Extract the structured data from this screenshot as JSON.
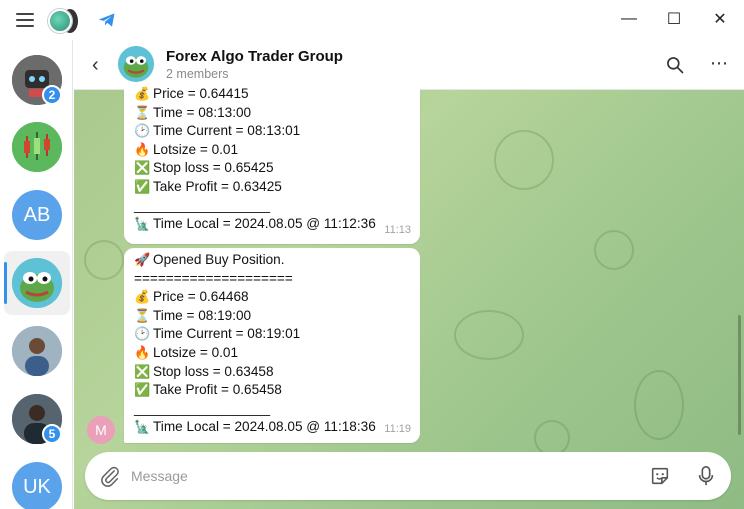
{
  "window": {
    "controls": {
      "minimize": "—",
      "maximize": "☐",
      "close": "✕"
    }
  },
  "rail": {
    "items": [
      {
        "name": "chat-1",
        "initials": "",
        "color": "#5b5b5b",
        "badge": "2"
      },
      {
        "name": "chat-2",
        "initials": "",
        "color": "#4caf50",
        "badge": ""
      },
      {
        "name": "chat-ab",
        "initials": "AB",
        "color": "#5aa3ea",
        "badge": ""
      },
      {
        "name": "chat-forex",
        "initials": "",
        "color": "#5fc1d6",
        "badge": "",
        "selected": true
      },
      {
        "name": "chat-5",
        "initials": "",
        "color": "#8a9aa6",
        "badge": ""
      },
      {
        "name": "chat-6",
        "initials": "",
        "color": "#4a5a66",
        "badge": "5"
      },
      {
        "name": "chat-uk",
        "initials": "UK",
        "color": "#5aa3ea",
        "badge": ""
      }
    ]
  },
  "header": {
    "title": "Forex Algo Trader Group",
    "subtitle": "2 members"
  },
  "messages": [
    {
      "lines": [
        {
          "icon": "💰",
          "text": "Price = 0.64415"
        },
        {
          "icon": "⏳",
          "text": "Time = 08:13:00"
        },
        {
          "icon": "🕑",
          "text": "Time Current = 08:13:01"
        },
        {
          "icon": "🔥",
          "text": "Lotsize = 0.01"
        },
        {
          "icon": "❎",
          "text": "Stop loss = 0.65425"
        },
        {
          "icon": "✅",
          "text": "Take Profit = 0.63425"
        },
        {
          "icon": "",
          "text": "__________________"
        },
        {
          "icon": "🗽",
          "text": "Time Local = 2024.08.05 @ 11:12:36"
        }
      ],
      "time": "11:13"
    },
    {
      "lines": [
        {
          "icon": "🚀",
          "text": "Opened Buy Position."
        },
        {
          "icon": "",
          "text": "===================="
        },
        {
          "icon": "💰",
          "text": "Price = 0.64468"
        },
        {
          "icon": "⏳",
          "text": "Time = 08:19:00"
        },
        {
          "icon": "🕑",
          "text": "Time Current = 08:19:01"
        },
        {
          "icon": "🔥",
          "text": "Lotsize = 0.01"
        },
        {
          "icon": "❎",
          "text": "Stop loss = 0.63458"
        },
        {
          "icon": "✅",
          "text": "Take Profit = 0.65458"
        },
        {
          "icon": "",
          "text": "__________________"
        },
        {
          "icon": "🗽",
          "text": "Time Local = 2024.08.05 @ 11:18:36"
        }
      ],
      "time": "11:19",
      "sender_initial": "M"
    }
  ],
  "composer": {
    "placeholder": "Message"
  },
  "colors": {
    "accent": "#3390ec",
    "chat_background": "#a9c98e"
  }
}
